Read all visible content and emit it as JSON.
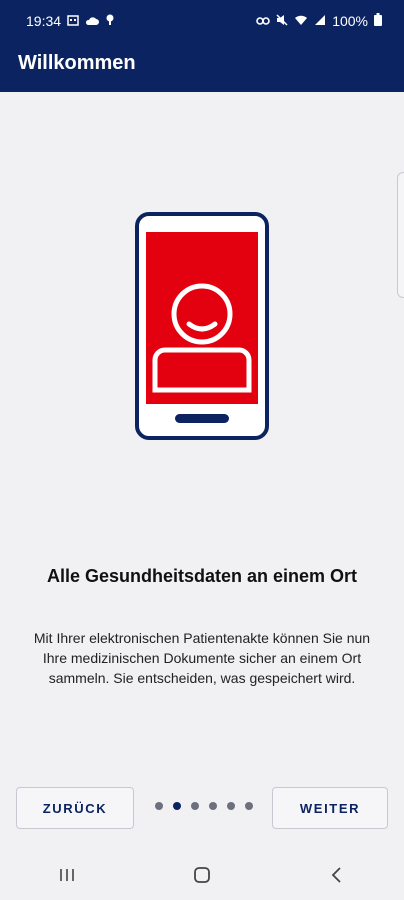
{
  "status": {
    "time": "19:34",
    "battery": "100%"
  },
  "app_bar": {
    "title": "Willkommen"
  },
  "onboarding": {
    "headline": "Alle Gesundheitsdaten an einem Ort",
    "description": "Mit Ihrer elektronischen Patientenakte können Sie nun Ihre medizinischen Dokumente sicher an einem Ort sammeln. Sie entscheiden, was gespeichert wird.",
    "back_label": "ZURÜCK",
    "next_label": "WEITER",
    "page_count": 6,
    "active_page": 2
  },
  "colors": {
    "brand": "#0b2461",
    "accent": "#e3000f",
    "background": "#f1f1f4"
  },
  "icons": {
    "status_left": [
      "calendar-icon",
      "cloud-icon",
      "location-icon"
    ],
    "status_right": [
      "link-icon",
      "mute-icon",
      "wifi-icon",
      "signal-icon",
      "battery-icon"
    ],
    "illustration": "smartphone-user-icon",
    "nav": [
      "recent-apps-icon",
      "home-icon",
      "back-icon"
    ]
  }
}
